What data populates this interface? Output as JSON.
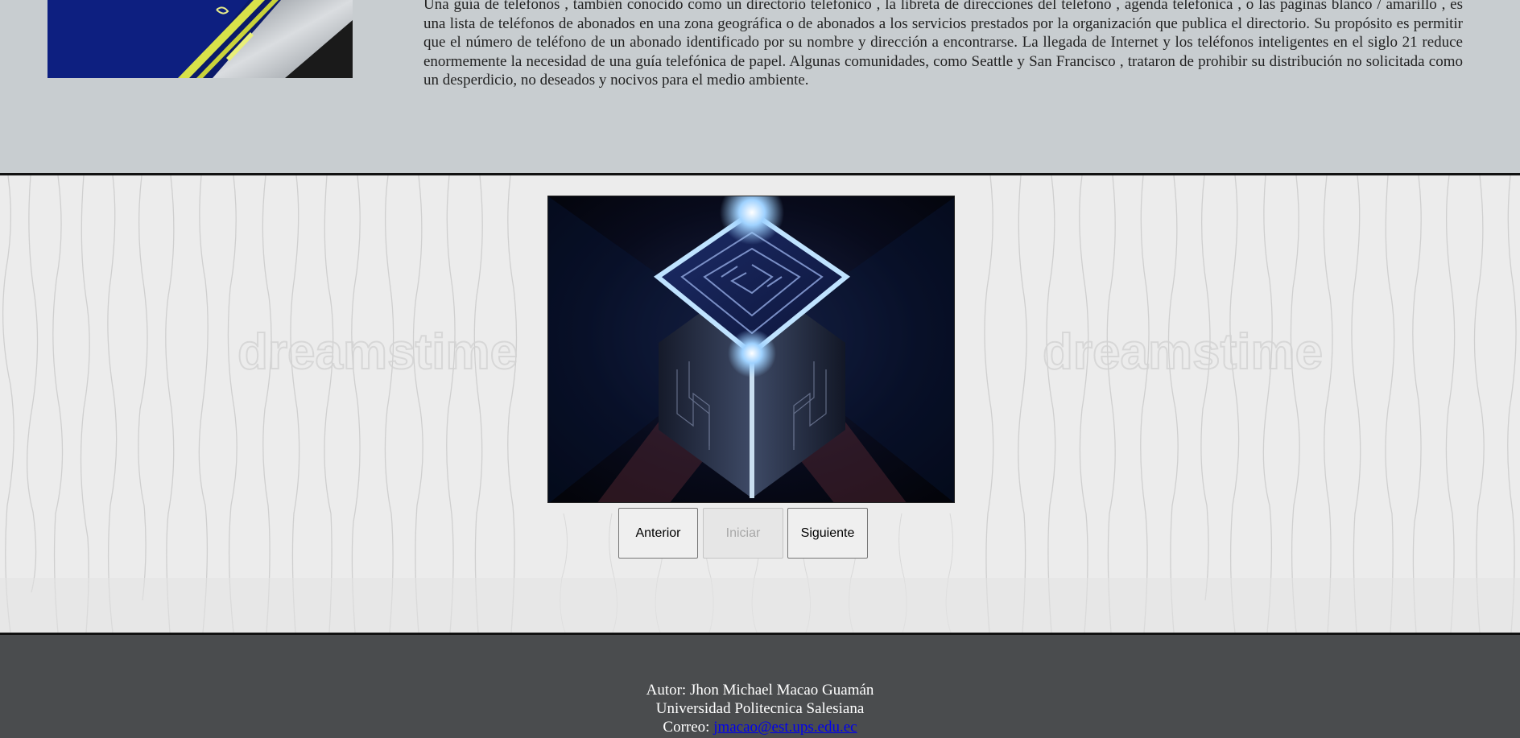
{
  "article": {
    "paragraph": "Una guía de teléfonos , también conocido como un directorio telefónico , la libreta de direcciones del teléfono , agenda telefónica , o las páginas blanco / amarillo , es una lista de teléfonos de abonados en una zona geográfica o de abonados a los servicios prestados por la organización que publica el directorio. Su propósito es permitir que el número de teléfono de un abonado identificado por su nombre y dirección a encontrarse. La llegada de Internet y los teléfonos inteligentes en el siglo 21 reduce enormemente la necesidad de una guía telefónica de papel. Algunas comunidades, como Seattle y San Francisco , trataron de prohibir su distribución no solicitada como un desperdicio, no deseados y nocivos para el medio ambiente."
  },
  "slideshow": {
    "prev_label": "Anterior",
    "start_label": "Iniciar",
    "next_label": "Siguiente",
    "start_disabled": true,
    "watermark": "dreamstime"
  },
  "footer": {
    "author": "Autor: Jhon Michael Macao Guamán",
    "university": "Universidad Politecnica Salesiana",
    "email_label": "Correo: ",
    "email": "jmacao@est.ups.edu.ec"
  },
  "colors": {
    "top_background": "#c8cdd0",
    "footer_background": "#4a4c4e",
    "link": "#0000ee",
    "slide_glow": "#9fd2ff"
  }
}
